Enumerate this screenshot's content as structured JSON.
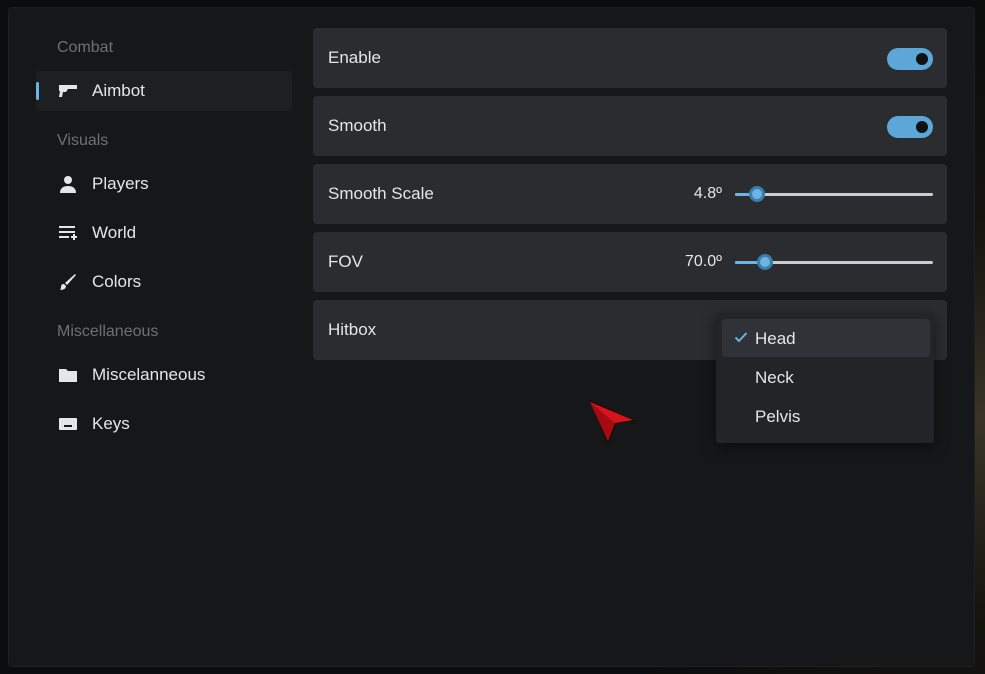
{
  "sidebar": {
    "sections": [
      {
        "header": "Combat",
        "items": [
          {
            "label": "Aimbot",
            "icon": "gun-icon",
            "active": true
          }
        ]
      },
      {
        "header": "Visuals",
        "items": [
          {
            "label": "Players",
            "icon": "person-icon"
          },
          {
            "label": "World",
            "icon": "list-add-icon"
          },
          {
            "label": "Colors",
            "icon": "brush-icon"
          }
        ]
      },
      {
        "header": "Miscellaneous",
        "items": [
          {
            "label": "Miscelanneous",
            "icon": "folder-icon"
          },
          {
            "label": "Keys",
            "icon": "keyboard-icon"
          }
        ]
      }
    ]
  },
  "settings": {
    "enable": {
      "label": "Enable",
      "value": true
    },
    "smooth": {
      "label": "Smooth",
      "value": true
    },
    "smooth_scale": {
      "label": "Smooth Scale",
      "value_text": "4.8º",
      "fraction": 0.11
    },
    "fov": {
      "label": "FOV",
      "value_text": "70.0º",
      "fraction": 0.15
    },
    "hitbox": {
      "label": "Hitbox",
      "options": [
        "Head",
        "Neck",
        "Pelvis"
      ],
      "selected": "Head"
    }
  },
  "colors": {
    "accent": "#6cb4e3",
    "toggle_on": "#5da6d8",
    "row_bg": "#2a2c2f",
    "window_bg": "#151719",
    "cursor": "#d8141b"
  }
}
